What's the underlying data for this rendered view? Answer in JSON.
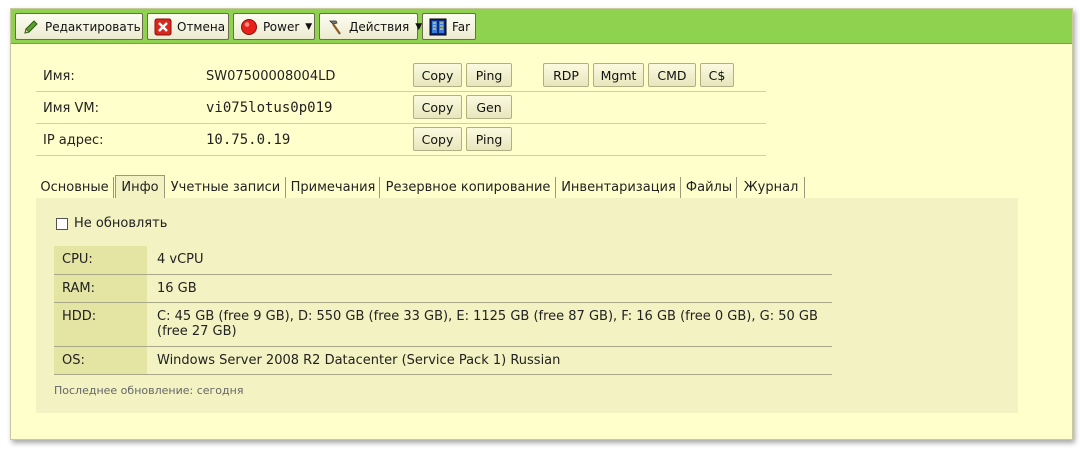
{
  "toolbar": {
    "edit_label": "Редактировать",
    "cancel_label": "Отмена",
    "power_label": "Power",
    "actions_label": "Действия",
    "far_label": "Far"
  },
  "properties": {
    "name_label": "Имя:",
    "name_value": "SW07500008004LD",
    "vm_label": "Имя VM:",
    "vm_value": "vi075lotus0p019",
    "ip_label": "IP адрес:",
    "ip_value": "10.75.0.19",
    "copy_label": "Copy",
    "ping_label": "Ping",
    "gen_label": "Gen",
    "rdp_label": "RDP",
    "mgmt_label": "Mgmt",
    "cmd_label": "CMD",
    "cs_label": "C$"
  },
  "tabs": [
    {
      "label": "Основные"
    },
    {
      "label": "Инфо"
    },
    {
      "label": "Учетные записи"
    },
    {
      "label": "Примечания"
    },
    {
      "label": "Резервное копирование"
    },
    {
      "label": "Инвентаризация"
    },
    {
      "label": "Файлы"
    },
    {
      "label": "Журнал"
    }
  ],
  "info": {
    "no_update_label": "Не обновлять",
    "rows": [
      {
        "label": "CPU:",
        "value": "4 vCPU"
      },
      {
        "label": "RAM:",
        "value": "16 GB"
      },
      {
        "label": "HDD:",
        "value": "C: 45 GB (free 9 GB), D: 550 GB (free 33 GB), E: 1125 GB (free 87 GB), F: 16 GB (free 0 GB), G: 50 GB (free 27 GB)"
      },
      {
        "label": "OS:",
        "value": "Windows Server 2008 R2 Datacenter (Service Pack 1) Russian"
      }
    ],
    "last_update": "Последнее обновление: сегодня"
  },
  "colors": {
    "toolbar": "#8fd24f",
    "background": "#ffffcc",
    "panel": "#f2f2c2",
    "label_cell": "#e4e4a3"
  }
}
